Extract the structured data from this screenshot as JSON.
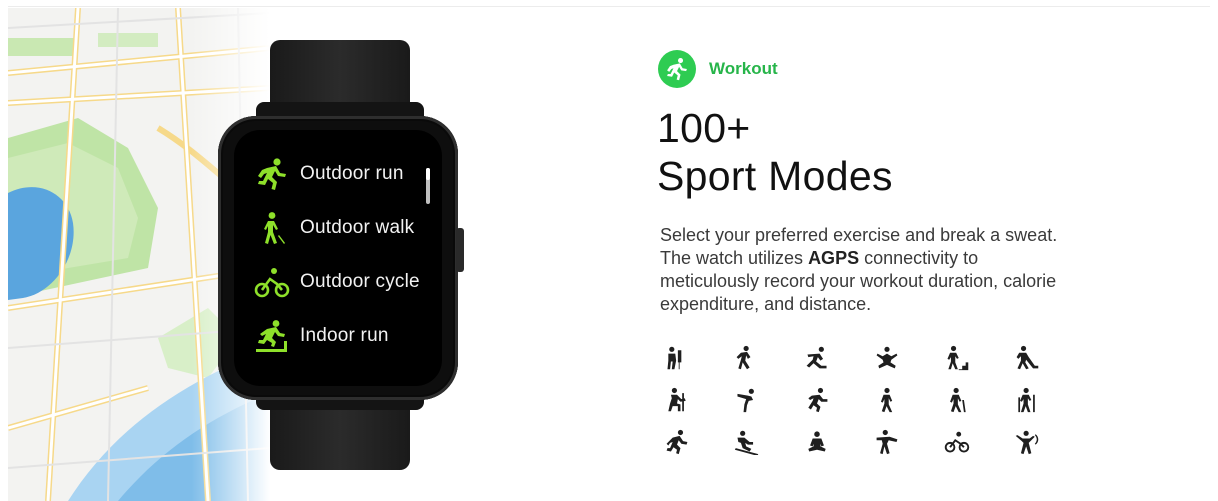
{
  "badge": {
    "label": "Workout",
    "icon": "running-person-icon",
    "color": "#2ecc52"
  },
  "headline": {
    "line1": "100+",
    "line2": "Sport Modes"
  },
  "description": {
    "part1": "Select your preferred exercise and break a sweat. The watch utilizes ",
    "bold": "AGPS",
    "part2": " connectivity to meticulously record your workout duration, calorie expenditure, and distance."
  },
  "watch": {
    "menu": [
      {
        "label": "Outdoor run",
        "icon": "outdoor-run-icon"
      },
      {
        "label": "Outdoor walk",
        "icon": "outdoor-walk-icon"
      },
      {
        "label": "Outdoor cycle",
        "icon": "outdoor-cycle-icon"
      },
      {
        "label": "Indoor run",
        "icon": "indoor-run-icon"
      }
    ],
    "accent_color": "#8ee02a"
  },
  "sport_icons": [
    "boxing-icon",
    "climbing-icon",
    "skating-icon",
    "yoga-icon",
    "stair-stepper-icon",
    "hockey-icon",
    "rowing-icon",
    "gymnastics-icon",
    "dance-icon",
    "walking-icon",
    "hiking-icon",
    "trekking-icon",
    "running-icon",
    "skiing-icon",
    "meditation-icon",
    "martial-arts-icon",
    "cycling-icon",
    "cheer-icon"
  ]
}
